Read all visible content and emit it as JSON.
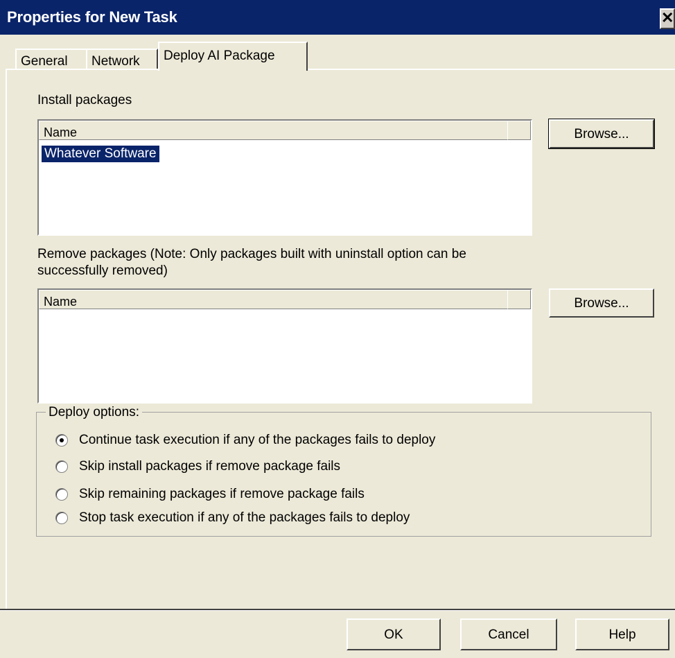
{
  "window": {
    "title": "Properties for New Task",
    "close_label": "✕"
  },
  "tabs": [
    {
      "label": "General",
      "selected": false
    },
    {
      "label": "Network",
      "selected": false
    },
    {
      "label": "Deploy AI Package",
      "selected": true
    }
  ],
  "install": {
    "label": "Install packages",
    "column_header": "Name",
    "items": [
      "Whatever Software"
    ],
    "browse_label": "Browse..."
  },
  "remove": {
    "label_line1": "Remove packages (Note:  Only packages built with uninstall option can be",
    "label_line2": "successfully removed)",
    "column_header": "Name",
    "items": [],
    "browse_label": "Browse..."
  },
  "deploy_options": {
    "legend": "Deploy options:",
    "options": [
      {
        "label": "Continue task execution if any of the packages fails to deploy",
        "selected": true
      },
      {
        "label": "Skip install packages if remove package fails",
        "selected": false
      },
      {
        "label": "Skip remaining packages if remove package fails",
        "selected": false
      },
      {
        "label": "Stop task execution if any of the packages fails to deploy",
        "selected": false
      }
    ]
  },
  "footer": {
    "ok_label": "OK",
    "cancel_label": "Cancel",
    "help_label": "Help"
  },
  "colors": {
    "titlebar": "#0a246a",
    "face": "#ece9d8",
    "selection": "#0a246a"
  }
}
